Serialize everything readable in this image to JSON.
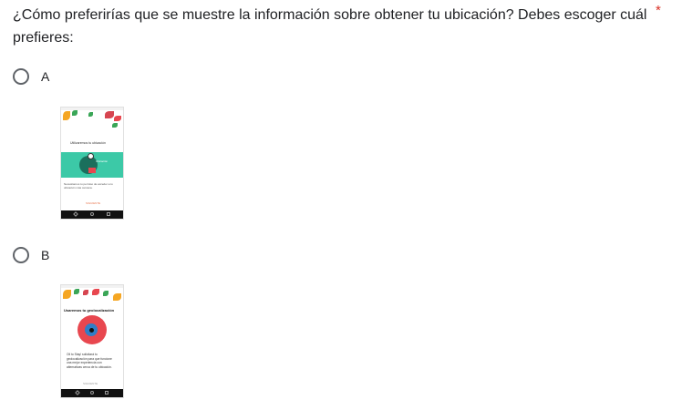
{
  "question": {
    "text": "¿Cómo preferirías que se muestre la información sobre obtener tu ubicación? Debes escoger cuál prefieres:",
    "required_mark": "*"
  },
  "options": [
    {
      "label": "A",
      "image": {
        "heading": "Utilizaremos tu ubicación",
        "banner_text": "Ubicación",
        "body_text": "Necesitamos tu permiso de acceder a tu ubicación más cercana.",
        "button_text": "SIGUIENTE"
      }
    },
    {
      "label": "B",
      "image": {
        "heading": "Usaremos tu geolocalización",
        "body_text": "Oil to Stay! solicitará tu geolocalización para que funcione una mejor experiencia con alternativas cerca de tu ubicación.",
        "button_text": "SIGUIENTE"
      }
    }
  ],
  "colors": {
    "accent_teal": "#3cc9a7",
    "accent_red": "#e8474f",
    "required": "#d93025"
  }
}
